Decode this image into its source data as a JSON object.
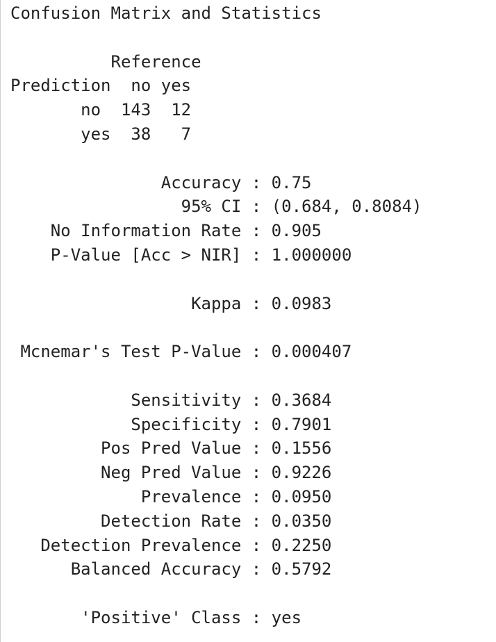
{
  "console": {
    "lines": [
      "Confusion Matrix and Statistics",
      "",
      "          Reference",
      "Prediction  no yes",
      "       no  143  12",
      "       yes  38   7",
      "",
      "               Accuracy : 0.75",
      "                 95% CI : (0.684, 0.8084)",
      "    No Information Rate : 0.905",
      "    P-Value [Acc > NIR] : 1.000000",
      "",
      "                  Kappa : 0.0983",
      "",
      " Mcnemar's Test P-Value : 0.000407",
      "",
      "            Sensitivity : 0.3684",
      "            Specificity : 0.7901",
      "         Pos Pred Value : 0.1556",
      "         Neg Pred Value : 0.9226",
      "             Prevalence : 0.0950",
      "         Detection Rate : 0.0350",
      "   Detection Prevalence : 0.2250",
      "      Balanced Accuracy : 0.5792",
      "",
      "       'Positive' Class : yes"
    ]
  }
}
